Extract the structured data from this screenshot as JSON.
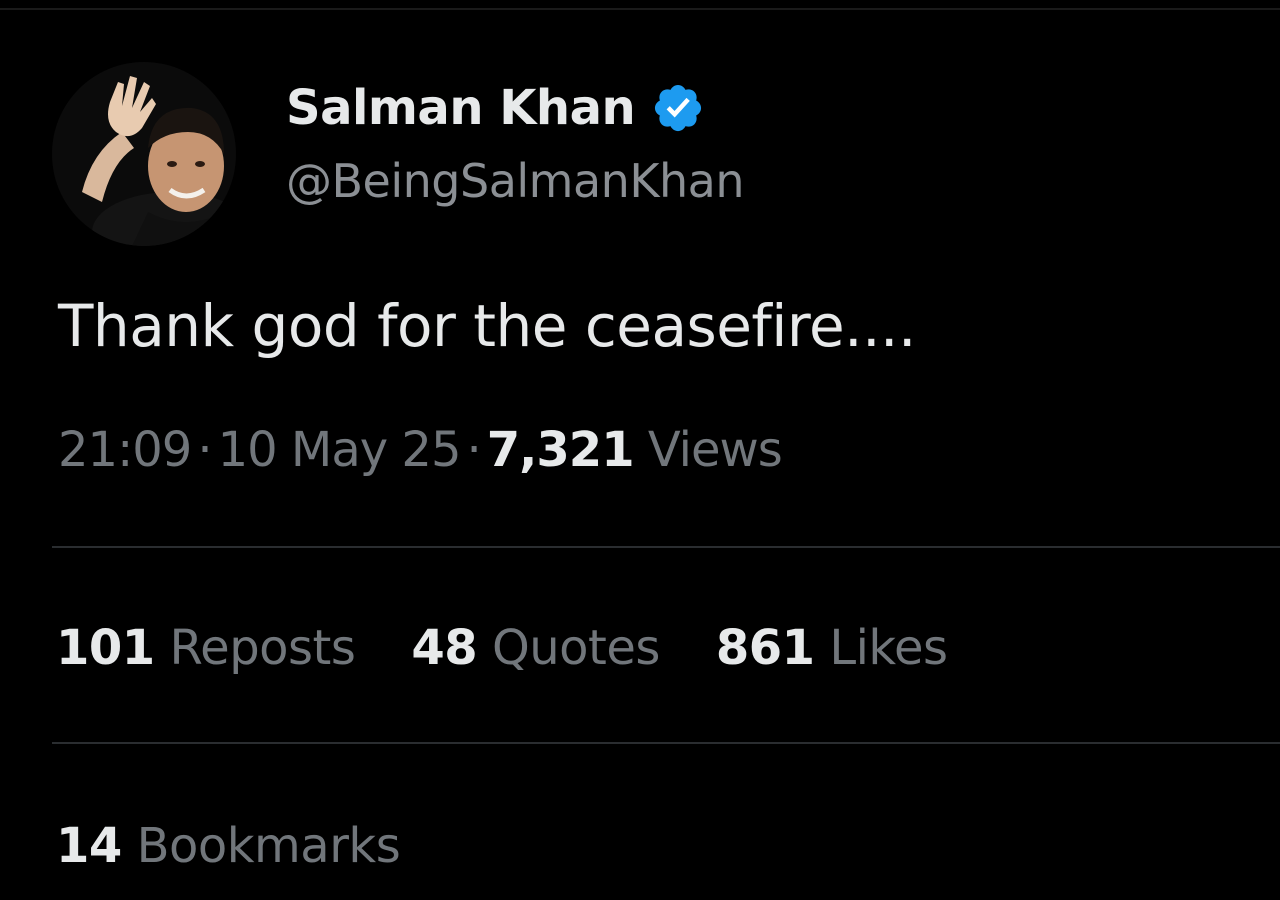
{
  "tweet": {
    "author": {
      "display_name": "Salman Khan",
      "handle": "@BeingSalmanKhan",
      "verified": true,
      "avatar_icon": "profile-photo-avatar",
      "verified_icon": "verified-badge-icon"
    },
    "text": "Thank god for the ceasefire....",
    "meta": {
      "time": "21:09",
      "separator": "·",
      "date": "10 May 25",
      "views_count": "7,321",
      "views_label": "Views"
    },
    "stats": [
      {
        "count": "101",
        "label": "Reposts"
      },
      {
        "count": "48",
        "label": "Quotes"
      },
      {
        "count": "861",
        "label": "Likes"
      }
    ],
    "bookmarks": {
      "count": "14",
      "label": "Bookmarks"
    }
  },
  "colors": {
    "background": "#000000",
    "primary_text": "#e7e9ea",
    "secondary_text": "#71767b",
    "verified_blue": "#1d9bf0",
    "divider": "#2a2d30"
  }
}
